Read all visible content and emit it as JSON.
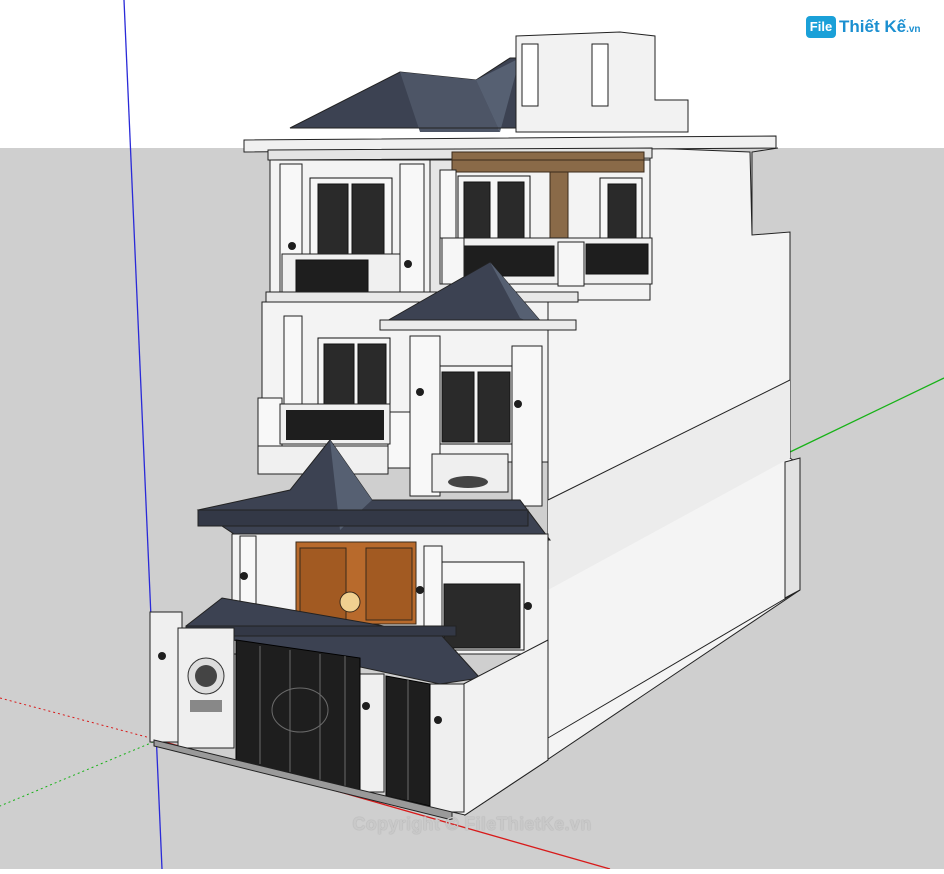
{
  "viewport": {
    "sky_color": "#ffffff",
    "ground_color": "#cfcfcf",
    "axis_blue": "#2a2ad8",
    "axis_green": "#17b217",
    "axis_red": "#d81a1a"
  },
  "colors": {
    "wall_white": "#f2f2f2",
    "wall_shade": "#dedede",
    "roof_dark": "#3c4252",
    "roof_light": "#566072",
    "door_wood": "#b86a2c",
    "wood_beam": "#8a6a48",
    "iron_black": "#1e1e1e",
    "outline": "#222222"
  },
  "icons": {
    "brand": "filethietke-logo-icon"
  },
  "branding": {
    "logo_mark": "File",
    "logo_word": "Thiết Kế",
    "logo_suffix": ".vn"
  },
  "watermark": {
    "copyright": "Copyright © FileThietKe.vn"
  }
}
